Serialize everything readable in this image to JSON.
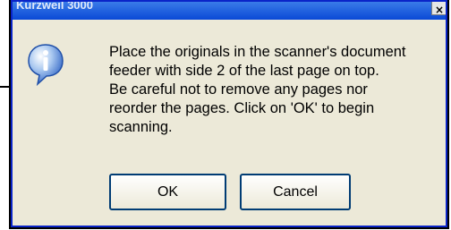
{
  "dialog": {
    "title": "Kurzweil 3000",
    "close_label": "×",
    "icon": "info-icon",
    "message": "Place the originals in the scanner's document\nfeeder with side 2 of the last page on top.\n Be careful not to remove any pages nor\nreorder the pages.  Click on 'OK' to begin\nscanning.",
    "buttons": {
      "ok_label": "OK",
      "cancel_label": "Cancel"
    }
  },
  "colors": {
    "title_bar": "#0a49d6",
    "dialog_face": "#ece9d8",
    "button_border": "#003c74",
    "icon_blue": "#3b78d8"
  }
}
